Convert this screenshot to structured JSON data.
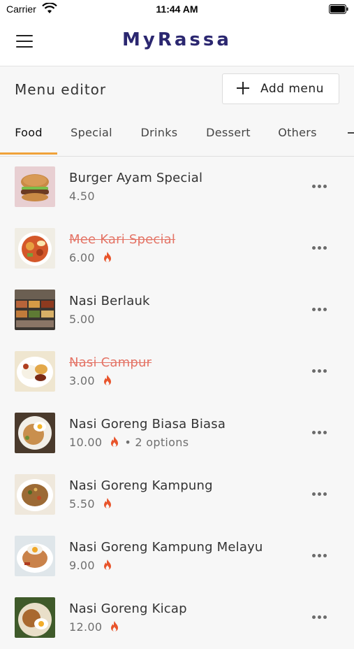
{
  "status_bar": {
    "carrier": "Carrier",
    "time": "11:44 AM"
  },
  "navbar": {
    "title": "MyRassa",
    "menu_icon": "hamburger-menu-icon"
  },
  "editor": {
    "title": "Menu editor",
    "add_label": "Add menu",
    "add_icon": "plus-icon"
  },
  "tabs": [
    {
      "label": "Food",
      "active": true
    },
    {
      "label": "Special",
      "active": false
    },
    {
      "label": "Drinks",
      "active": false
    },
    {
      "label": "Dessert",
      "active": false
    },
    {
      "label": "Others",
      "active": false
    }
  ],
  "items": [
    {
      "name": "Burger Ayam Special",
      "price": "4.50",
      "unavailable": false,
      "hot": false,
      "options": "",
      "icon": "burger-photo"
    },
    {
      "name": "Mee Kari Special",
      "price": "6.00",
      "unavailable": true,
      "hot": true,
      "options": "",
      "icon": "curry-noodle-photo"
    },
    {
      "name": "Nasi Berlauk",
      "price": "5.00",
      "unavailable": false,
      "hot": false,
      "options": "",
      "icon": "rice-dishes-photo"
    },
    {
      "name": "Nasi Campur",
      "price": "3.00",
      "unavailable": true,
      "hot": true,
      "options": "",
      "icon": "mixed-rice-photo"
    },
    {
      "name": "Nasi Goreng Biasa Biasa",
      "price": "10.00",
      "unavailable": false,
      "hot": true,
      "options": "• 2 options",
      "icon": "fried-rice-photo"
    },
    {
      "name": "Nasi Goreng Kampung",
      "price": "5.50",
      "unavailable": false,
      "hot": true,
      "options": "",
      "icon": "fried-rice-photo"
    },
    {
      "name": "Nasi Goreng Kampung Melayu",
      "price": "9.00",
      "unavailable": false,
      "hot": true,
      "options": "",
      "icon": "fried-rice-photo"
    },
    {
      "name": "Nasi Goreng Kicap",
      "price": "12.00",
      "unavailable": false,
      "hot": true,
      "options": "",
      "icon": "fried-rice-photo"
    }
  ],
  "colors": {
    "brand": "#2b2770",
    "tab_indicator": "#f0a23a",
    "unavailable": "#e47466",
    "fire": "#e8542b"
  }
}
